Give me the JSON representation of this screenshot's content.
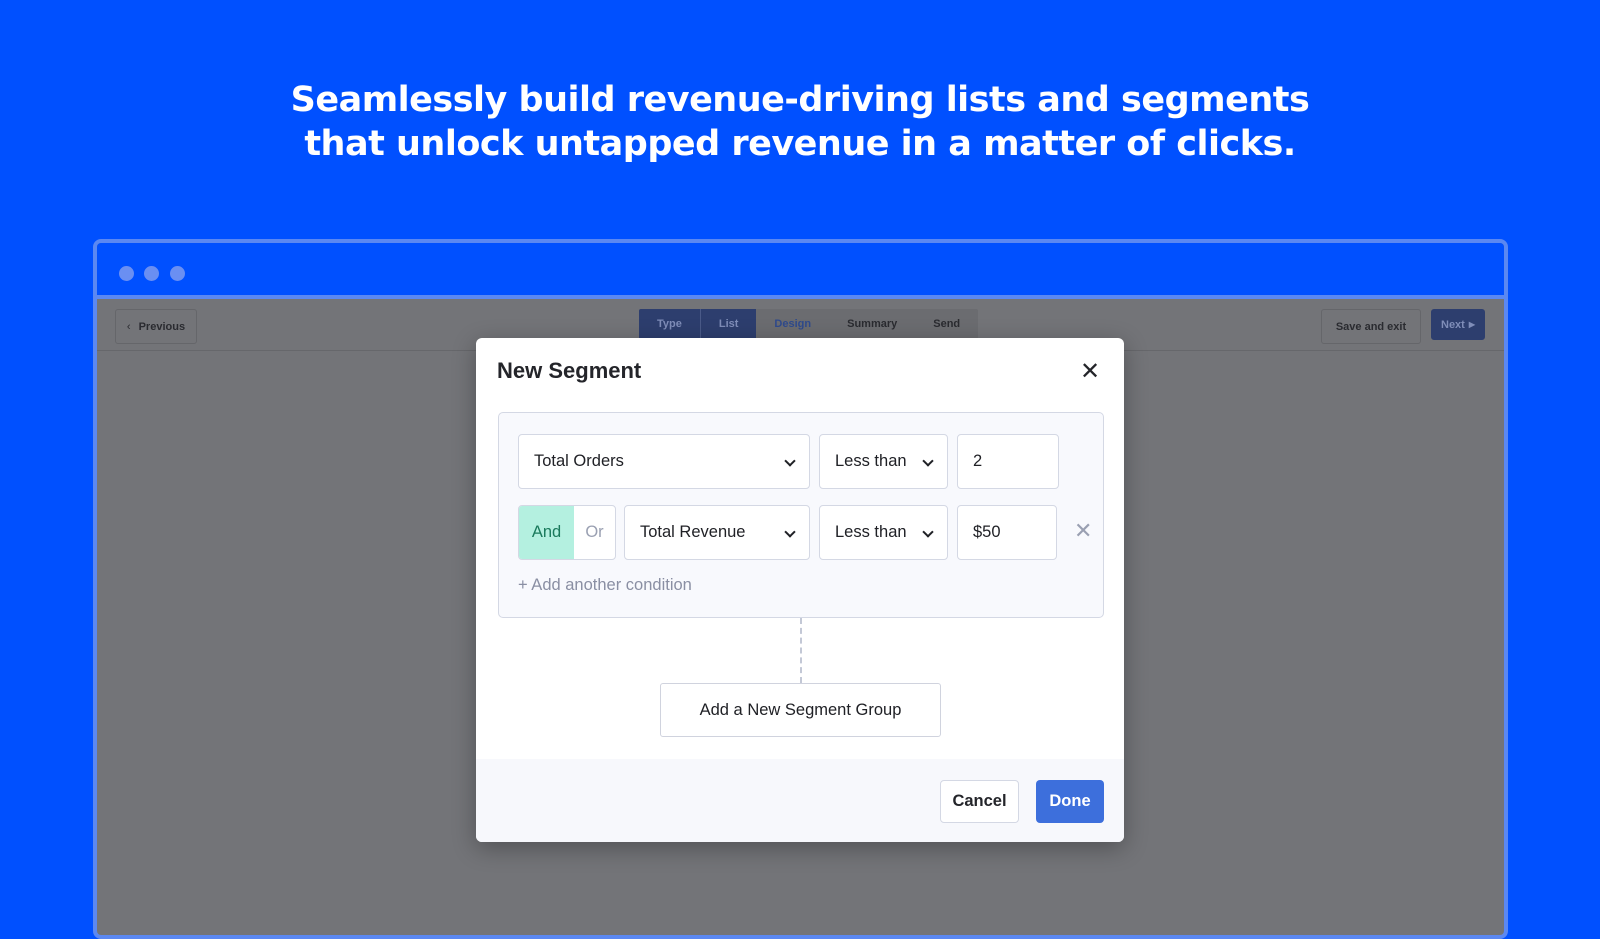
{
  "headline": {
    "line1": "Seamlessly build revenue-driving lists and segments",
    "line2": "that unlock untapped revenue in a matter of clicks."
  },
  "toolbar": {
    "previous": "Previous",
    "save_exit": "Save and exit",
    "next": "Next",
    "steps": [
      {
        "label": "Type"
      },
      {
        "label": "List"
      },
      {
        "label": "Design"
      },
      {
        "label": "Summary"
      },
      {
        "label": "Send"
      }
    ]
  },
  "modal": {
    "title": "New Segment",
    "conditions": [
      {
        "field": "Total Orders",
        "operator": "Less than",
        "value": "2"
      },
      {
        "connector_and": "And",
        "connector_or": "Or",
        "connector_selected": "And",
        "field": "Total Revenue",
        "operator": "Less than",
        "value": "$50"
      }
    ],
    "add_condition": "+ Add another condition",
    "add_group": "Add a New Segment Group",
    "cancel": "Cancel",
    "done": "Done"
  },
  "colors": {
    "background": "#0050ff",
    "accent": "#3d6fdc",
    "and_selected": "#b4f0e0"
  }
}
